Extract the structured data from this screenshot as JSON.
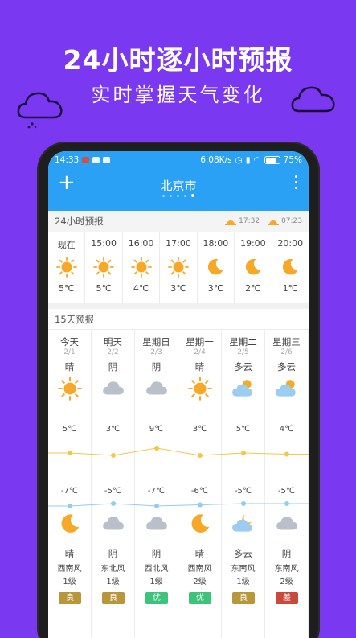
{
  "promo": {
    "headline": "24小时逐小时预报",
    "subline": "实时掌握天气变化"
  },
  "status": {
    "time": "14:33",
    "speed": "6.08K/s",
    "battery": "75%"
  },
  "appbar": {
    "city": "北京市"
  },
  "hourly": {
    "title": "24小时预报",
    "sunrise": "17:32",
    "sunset": "07:23",
    "items": [
      {
        "time": "现在",
        "icon": "sun-icon",
        "temp": "5℃"
      },
      {
        "time": "15:00",
        "icon": "sun-icon",
        "temp": "5℃"
      },
      {
        "time": "16:00",
        "icon": "sun-icon",
        "temp": "4℃"
      },
      {
        "time": "17:00",
        "icon": "sun-icon",
        "temp": "3℃"
      },
      {
        "time": "18:00",
        "icon": "moon-icon",
        "temp": "3℃"
      },
      {
        "time": "19:00",
        "icon": "moon-icon",
        "temp": "2℃"
      },
      {
        "time": "20:00",
        "icon": "moon-icon",
        "temp": "1℃"
      }
    ]
  },
  "daily": {
    "title": "15天预报",
    "items": [
      {
        "day": "今天",
        "date": "2/1",
        "cond": "晴",
        "icon": "sun-icon",
        "hi": "5℃",
        "lo": "-7℃",
        "night_icon": "moon-icon",
        "night_cond": "晴",
        "wind": "西南风",
        "level": "1级",
        "aqi": "良",
        "aqi_color": "#b8973a"
      },
      {
        "day": "明天",
        "date": "2/2",
        "cond": "阴",
        "icon": "cloud-icon",
        "hi": "3℃",
        "lo": "-5℃",
        "night_icon": "cloud-icon",
        "night_cond": "阴",
        "wind": "东北风",
        "level": "1级",
        "aqi": "良",
        "aqi_color": "#b8973a"
      },
      {
        "day": "星期日",
        "date": "2/3",
        "cond": "阴",
        "icon": "cloud-icon",
        "hi": "9℃",
        "lo": "-7℃",
        "night_icon": "cloud-icon",
        "night_cond": "阴",
        "wind": "西北风",
        "level": "1级",
        "aqi": "优",
        "aqi_color": "#3cc47a"
      },
      {
        "day": "星期一",
        "date": "2/4",
        "cond": "晴",
        "icon": "sun-icon",
        "hi": "3℃",
        "lo": "-6℃",
        "night_icon": "moon-icon",
        "night_cond": "晴",
        "wind": "西南风",
        "level": "2级",
        "aqi": "优",
        "aqi_color": "#3cc47a"
      },
      {
        "day": "星期二",
        "date": "2/5",
        "cond": "多云",
        "icon": "partly-cloudy-icon",
        "hi": "5℃",
        "lo": "-5℃",
        "night_icon": "partly-cloudy-night-icon",
        "night_cond": "多云",
        "wind": "东南风",
        "level": "1级",
        "aqi": "良",
        "aqi_color": "#b8973a"
      },
      {
        "day": "星期三",
        "date": "2/6",
        "cond": "多云",
        "icon": "partly-cloudy-icon",
        "hi": "4℃",
        "lo": "-5℃",
        "night_icon": "cloud-icon",
        "night_cond": "阴",
        "wind": "东南风",
        "level": "2级",
        "aqi": "差",
        "aqi_color": "#c94a3d"
      }
    ]
  },
  "chart_data": {
    "type": "line",
    "x": [
      "今天",
      "明天",
      "星期日",
      "星期一",
      "星期二",
      "星期三"
    ],
    "series": [
      {
        "values": [
          5,
          3,
          9,
          3,
          5,
          4
        ]
      },
      {
        "values": [
          -7,
          -5,
          -7,
          -6,
          -5,
          -5
        ]
      }
    ]
  },
  "colors": {
    "accent": "#2aa1f4",
    "sun": "#f7a826",
    "cloud": "#b9c0c9",
    "high_line": "#f5c648",
    "low_line": "#8fcdf2"
  }
}
